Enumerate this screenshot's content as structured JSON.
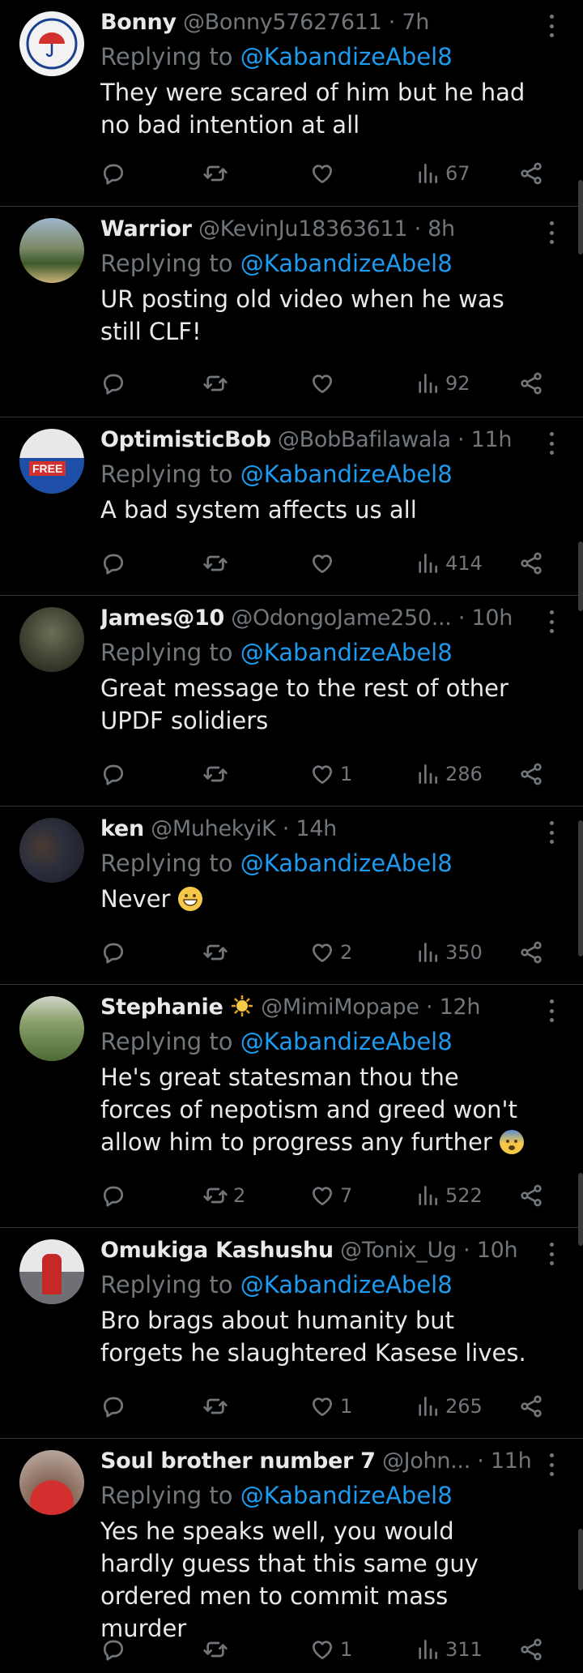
{
  "colors": {
    "background": "#000000",
    "text": "#e7e9ea",
    "muted": "#71767b",
    "link": "#1d9bf0",
    "divider": "#2f3336"
  },
  "replies": [
    {
      "name": "Bonny",
      "handle": "@Bonny57627611",
      "dot": "·",
      "time": "7h",
      "replying_label": "Replying to",
      "replying_to": "@KabandizeAbel8",
      "text": "They were scared of him but he had no bad intention at all",
      "retweets": "",
      "likes": "",
      "views": "67"
    },
    {
      "name": "Warrior",
      "handle": "@KevinJu18363611",
      "dot": "·",
      "time": "8h",
      "replying_label": "Replying to",
      "replying_to": "@KabandizeAbel8",
      "text": "UR posting old video when he was still CLF!",
      "retweets": "",
      "likes": "",
      "views": "92"
    },
    {
      "name": "OptimisticBob",
      "handle": "@BobBafilawala",
      "dot": "·",
      "time": "11h",
      "replying_label": "Replying to",
      "replying_to": "@KabandizeAbel8",
      "text": "A bad system affects us all",
      "retweets": "",
      "likes": "",
      "views": "414"
    },
    {
      "name": "James@10",
      "handle": "@OdongoJame250...",
      "dot": "·",
      "time": "10h",
      "replying_label": "Replying to",
      "replying_to": "@KabandizeAbel8",
      "text": "Great message to the rest of other UPDF solidiers",
      "retweets": "",
      "likes": "1",
      "views": "286"
    },
    {
      "name": "ken",
      "handle": "@MuhekyiK",
      "dot": "·",
      "time": "14h",
      "replying_label": "Replying to",
      "replying_to": "@KabandizeAbel8",
      "text": "Never",
      "retweets": "",
      "likes": "2",
      "views": "350"
    },
    {
      "name": "Stephanie",
      "handle": "@MimiMopape",
      "dot": "·",
      "time": "12h",
      "replying_label": "Replying to",
      "replying_to": "@KabandizeAbel8",
      "text": "He's great statesman thou the forces of nepotism and greed won't allow him to progress any further",
      "retweets": "2",
      "likes": "7",
      "views": "522"
    },
    {
      "name": "Omukiga Kashushu",
      "handle": "@Tonix_Ug",
      "dot": "·",
      "time": "10h",
      "replying_label": "Replying to",
      "replying_to": "@KabandizeAbel8",
      "text": "Bro brags about humanity but forgets he slaughtered Kasese lives.",
      "retweets": "",
      "likes": "1",
      "views": "265"
    },
    {
      "name": "Soul brother number 7",
      "handle": "@John...",
      "dot": "·",
      "time": "11h",
      "replying_label": "Replying to",
      "replying_to": "@KabandizeAbel8",
      "text": "Yes he speaks well, you would hardly guess that this same guy ordered men to commit mass murder",
      "retweets": "",
      "likes": "1",
      "views": "311"
    }
  ]
}
